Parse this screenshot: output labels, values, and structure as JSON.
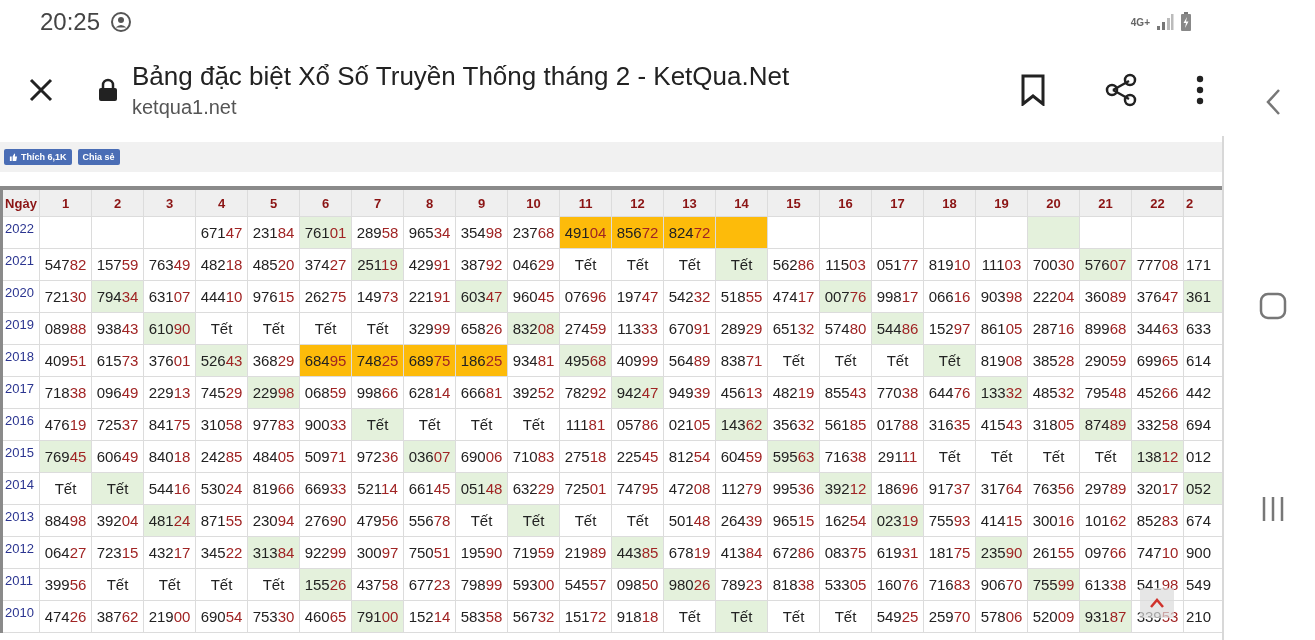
{
  "status_bar": {
    "time": "20:25",
    "network": "4G+"
  },
  "browser": {
    "title": "Bảng đặc biệt Xổ Số Truyền Thống tháng 2 - KetQua.Net",
    "url": "ketqua1.net"
  },
  "social": {
    "like_button": "Thích 6,1K",
    "share_button": "Chia sẻ"
  },
  "table": {
    "corner": "Ngày",
    "columns": [
      "1",
      "2",
      "3",
      "4",
      "5",
      "6",
      "7",
      "8",
      "9",
      "10",
      "11",
      "12",
      "13",
      "14",
      "15",
      "16",
      "17",
      "18",
      "19",
      "20",
      "21",
      "22",
      "2"
    ],
    "rows": [
      {
        "year": "2022",
        "cells": [
          {},
          {},
          {},
          {
            "text": "67147"
          },
          {
            "text": "23184"
          },
          {
            "text": "76101",
            "color": "#e4f1dc"
          },
          {
            "text": "28958"
          },
          {
            "text": "96534"
          },
          {
            "text": "35498"
          },
          {
            "text": "23768"
          },
          {
            "text": "49104",
            "color": "#fdbb0a"
          },
          {
            "text": "85672",
            "color": "#fdbb0a"
          },
          {
            "text": "82472",
            "color": "#fdbb0a"
          },
          {
            "color": "#fdbb0a"
          },
          {},
          {},
          {},
          {},
          {},
          {
            "color": "#e4f1dc"
          },
          {},
          {},
          {}
        ]
      },
      {
        "year": "2021",
        "cells": [
          {
            "text": "54782"
          },
          {
            "text": "15759"
          },
          {
            "text": "76349"
          },
          {
            "text": "48218"
          },
          {
            "text": "48520"
          },
          {
            "text": "37427"
          },
          {
            "text": "25119",
            "color": "#e4f1dc"
          },
          {
            "text": "42991"
          },
          {
            "text": "38792"
          },
          {
            "text": "04629"
          },
          {
            "text": "Tết"
          },
          {
            "text": "Tết"
          },
          {
            "text": "Tết"
          },
          {
            "text": "Tết",
            "color": "#e4f1dc"
          },
          {
            "text": "56286"
          },
          {
            "text": "11503"
          },
          {
            "text": "05177"
          },
          {
            "text": "81910"
          },
          {
            "text": "11103"
          },
          {
            "text": "70030"
          },
          {
            "text": "57607",
            "color": "#e4f1dc"
          },
          {
            "text": "77708"
          },
          {
            "text": "171"
          }
        ]
      },
      {
        "year": "2020",
        "cells": [
          {
            "text": "72130"
          },
          {
            "text": "79434",
            "color": "#e4f1dc"
          },
          {
            "text": "63107"
          },
          {
            "text": "44410"
          },
          {
            "text": "97615"
          },
          {
            "text": "26275"
          },
          {
            "text": "14973"
          },
          {
            "text": "22191"
          },
          {
            "text": "60347",
            "color": "#e4f1dc"
          },
          {
            "text": "96045"
          },
          {
            "text": "07696"
          },
          {
            "text": "19747"
          },
          {
            "text": "54232"
          },
          {
            "text": "51855"
          },
          {
            "text": "47417"
          },
          {
            "text": "00776",
            "color": "#e4f1dc"
          },
          {
            "text": "99817"
          },
          {
            "text": "06616"
          },
          {
            "text": "90398"
          },
          {
            "text": "22204"
          },
          {
            "text": "36089"
          },
          {
            "text": "37647"
          },
          {
            "text": "361",
            "color": "#e4f1dc"
          }
        ]
      },
      {
        "year": "2019",
        "cells": [
          {
            "text": "08988"
          },
          {
            "text": "93843"
          },
          {
            "text": "61090",
            "color": "#e4f1dc"
          },
          {
            "text": "Tết"
          },
          {
            "text": "Tết"
          },
          {
            "text": "Tết"
          },
          {
            "text": "Tết"
          },
          {
            "text": "32999"
          },
          {
            "text": "65826"
          },
          {
            "text": "83208",
            "color": "#e4f1dc"
          },
          {
            "text": "27459"
          },
          {
            "text": "11333"
          },
          {
            "text": "67091"
          },
          {
            "text": "28929"
          },
          {
            "text": "65132"
          },
          {
            "text": "57480"
          },
          {
            "text": "54486",
            "color": "#e4f1dc"
          },
          {
            "text": "15297"
          },
          {
            "text": "86105"
          },
          {
            "text": "28716"
          },
          {
            "text": "89968"
          },
          {
            "text": "34463"
          },
          {
            "text": "633"
          }
        ]
      },
      {
        "year": "2018",
        "cells": [
          {
            "text": "40951"
          },
          {
            "text": "61573"
          },
          {
            "text": "37601"
          },
          {
            "text": "52643",
            "color": "#e4f1dc"
          },
          {
            "text": "36829"
          },
          {
            "text": "68495",
            "color": "#fdbb0a"
          },
          {
            "text": "74825",
            "color": "#fdbb0a"
          },
          {
            "text": "68975",
            "color": "#fdbb0a"
          },
          {
            "text": "18625",
            "color": "#fdbb0a"
          },
          {
            "text": "93481"
          },
          {
            "text": "49568",
            "color": "#e4f1dc"
          },
          {
            "text": "40999"
          },
          {
            "text": "56489"
          },
          {
            "text": "83871"
          },
          {
            "text": "Tết"
          },
          {
            "text": "Tết"
          },
          {
            "text": "Tết"
          },
          {
            "text": "Tết",
            "color": "#e4f1dc"
          },
          {
            "text": "81908"
          },
          {
            "text": "38528"
          },
          {
            "text": "29059"
          },
          {
            "text": "69965"
          },
          {
            "text": "614"
          }
        ]
      },
      {
        "year": "2017",
        "cells": [
          {
            "text": "71838"
          },
          {
            "text": "09649"
          },
          {
            "text": "22913"
          },
          {
            "text": "74529"
          },
          {
            "text": "22998",
            "color": "#e4f1dc"
          },
          {
            "text": "06859"
          },
          {
            "text": "99866"
          },
          {
            "text": "62814"
          },
          {
            "text": "66681"
          },
          {
            "text": "39252"
          },
          {
            "text": "78292"
          },
          {
            "text": "94247",
            "color": "#e4f1dc"
          },
          {
            "text": "94939"
          },
          {
            "text": "45613"
          },
          {
            "text": "48219"
          },
          {
            "text": "85543"
          },
          {
            "text": "77038"
          },
          {
            "text": "64476"
          },
          {
            "text": "13332",
            "color": "#e4f1dc"
          },
          {
            "text": "48532"
          },
          {
            "text": "79548"
          },
          {
            "text": "45266"
          },
          {
            "text": "442"
          }
        ]
      },
      {
        "year": "2016",
        "cells": [
          {
            "text": "47619"
          },
          {
            "text": "72537"
          },
          {
            "text": "84175"
          },
          {
            "text": "31058"
          },
          {
            "text": "97783"
          },
          {
            "text": "90033"
          },
          {
            "text": "Tết",
            "color": "#e4f1dc"
          },
          {
            "text": "Tết"
          },
          {
            "text": "Tết"
          },
          {
            "text": "Tết"
          },
          {
            "text": "11181"
          },
          {
            "text": "05786"
          },
          {
            "text": "02105"
          },
          {
            "text": "14362",
            "color": "#e4f1dc"
          },
          {
            "text": "35632"
          },
          {
            "text": "56185"
          },
          {
            "text": "01788"
          },
          {
            "text": "31635"
          },
          {
            "text": "41543"
          },
          {
            "text": "31805"
          },
          {
            "text": "87489",
            "color": "#e4f1dc"
          },
          {
            "text": "33258"
          },
          {
            "text": "694"
          }
        ]
      },
      {
        "year": "2015",
        "cells": [
          {
            "text": "76945",
            "color": "#e4f1dc"
          },
          {
            "text": "60649"
          },
          {
            "text": "84018"
          },
          {
            "text": "24285"
          },
          {
            "text": "48405"
          },
          {
            "text": "50971"
          },
          {
            "text": "97236"
          },
          {
            "text": "03607",
            "color": "#e4f1dc"
          },
          {
            "text": "69006"
          },
          {
            "text": "71083"
          },
          {
            "text": "27518"
          },
          {
            "text": "22545"
          },
          {
            "text": "81254"
          },
          {
            "text": "60459"
          },
          {
            "text": "59563",
            "color": "#e4f1dc"
          },
          {
            "text": "71638"
          },
          {
            "text": "29111"
          },
          {
            "text": "Tết"
          },
          {
            "text": "Tết"
          },
          {
            "text": "Tết"
          },
          {
            "text": "Tết"
          },
          {
            "text": "13812",
            "color": "#e4f1dc"
          },
          {
            "text": "012"
          }
        ]
      },
      {
        "year": "2014",
        "cells": [
          {
            "text": "Tết"
          },
          {
            "text": "Tết",
            "color": "#e4f1dc"
          },
          {
            "text": "54416"
          },
          {
            "text": "53024"
          },
          {
            "text": "81966"
          },
          {
            "text": "66933"
          },
          {
            "text": "52114"
          },
          {
            "text": "66145"
          },
          {
            "text": "05148",
            "color": "#e4f1dc"
          },
          {
            "text": "63229"
          },
          {
            "text": "72501"
          },
          {
            "text": "74795"
          },
          {
            "text": "47208"
          },
          {
            "text": "11279"
          },
          {
            "text": "99536"
          },
          {
            "text": "39212",
            "color": "#e4f1dc"
          },
          {
            "text": "18696"
          },
          {
            "text": "91737"
          },
          {
            "text": "31764"
          },
          {
            "text": "76356"
          },
          {
            "text": "29789"
          },
          {
            "text": "32017"
          },
          {
            "text": "052",
            "color": "#e4f1dc"
          }
        ]
      },
      {
        "year": "2013",
        "cells": [
          {
            "text": "88498"
          },
          {
            "text": "39204"
          },
          {
            "text": "48124",
            "color": "#e4f1dc"
          },
          {
            "text": "87155"
          },
          {
            "text": "23094"
          },
          {
            "text": "27690"
          },
          {
            "text": "47956"
          },
          {
            "text": "55678"
          },
          {
            "text": "Tết"
          },
          {
            "text": "Tết",
            "color": "#e4f1dc"
          },
          {
            "text": "Tết"
          },
          {
            "text": "Tết"
          },
          {
            "text": "50148"
          },
          {
            "text": "26439"
          },
          {
            "text": "96515"
          },
          {
            "text": "16254"
          },
          {
            "text": "02319",
            "color": "#e4f1dc"
          },
          {
            "text": "75593"
          },
          {
            "text": "41415"
          },
          {
            "text": "30016"
          },
          {
            "text": "10162"
          },
          {
            "text": "85283"
          },
          {
            "text": "674"
          }
        ]
      },
      {
        "year": "2012",
        "cells": [
          {
            "text": "06427"
          },
          {
            "text": "72315"
          },
          {
            "text": "43217"
          },
          {
            "text": "34522"
          },
          {
            "text": "31384",
            "color": "#e4f1dc"
          },
          {
            "text": "92299"
          },
          {
            "text": "30097"
          },
          {
            "text": "75051"
          },
          {
            "text": "19590"
          },
          {
            "text": "71959"
          },
          {
            "text": "21989"
          },
          {
            "text": "44385",
            "color": "#e4f1dc"
          },
          {
            "text": "67819"
          },
          {
            "text": "41384"
          },
          {
            "text": "67286"
          },
          {
            "text": "08375"
          },
          {
            "text": "61931"
          },
          {
            "text": "18175"
          },
          {
            "text": "23590",
            "color": "#e4f1dc"
          },
          {
            "text": "26155"
          },
          {
            "text": "09766"
          },
          {
            "text": "74710"
          },
          {
            "text": "900"
          }
        ]
      },
      {
        "year": "2011",
        "cells": [
          {
            "text": "39956"
          },
          {
            "text": "Tết"
          },
          {
            "text": "Tết"
          },
          {
            "text": "Tết"
          },
          {
            "text": "Tết"
          },
          {
            "text": "15526",
            "color": "#e4f1dc"
          },
          {
            "text": "43758"
          },
          {
            "text": "67723"
          },
          {
            "text": "79899"
          },
          {
            "text": "59300"
          },
          {
            "text": "54557"
          },
          {
            "text": "09850"
          },
          {
            "text": "98026",
            "color": "#e4f1dc"
          },
          {
            "text": "78923"
          },
          {
            "text": "81838"
          },
          {
            "text": "53305"
          },
          {
            "text": "16076"
          },
          {
            "text": "71683"
          },
          {
            "text": "90670"
          },
          {
            "text": "75599",
            "color": "#e4f1dc"
          },
          {
            "text": "61338"
          },
          {
            "text": "54198"
          },
          {
            "text": "549"
          }
        ]
      },
      {
        "year": "2010",
        "cells": [
          {
            "text": "47426"
          },
          {
            "text": "38762"
          },
          {
            "text": "21900"
          },
          {
            "text": "69054"
          },
          {
            "text": "75330"
          },
          {
            "text": "46065"
          },
          {
            "text": "79100",
            "color": "#e4f1dc"
          },
          {
            "text": "15214"
          },
          {
            "text": "58358"
          },
          {
            "text": "56732"
          },
          {
            "text": "15172"
          },
          {
            "text": "91818"
          },
          {
            "text": "Tết"
          },
          {
            "text": "Tết",
            "color": "#e4f1dc"
          },
          {
            "text": "Tết"
          },
          {
            "text": "Tết"
          },
          {
            "text": "54925"
          },
          {
            "text": "25970"
          },
          {
            "text": "57806"
          },
          {
            "text": "52009"
          },
          {
            "text": "93187",
            "color": "#e4f1dc"
          },
          {
            "text": "33953"
          },
          {
            "text": "210"
          }
        ]
      }
    ]
  }
}
